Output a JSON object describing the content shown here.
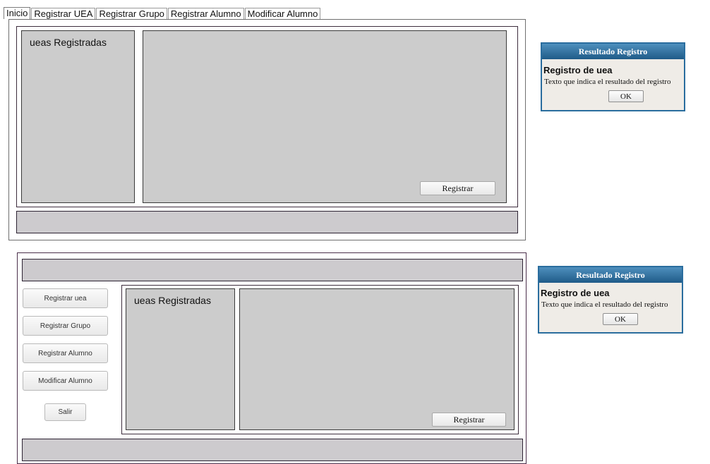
{
  "tabs": [
    "Inicio",
    "Registrar UEA",
    "Registrar Grupo",
    "Registrar Alumno",
    "Modificar Alumno"
  ],
  "mockup1": {
    "list_title": "ueas Registradas",
    "register_button": "Registrar"
  },
  "dialog1": {
    "title": "Resultado Registro",
    "heading": "Registro de uea",
    "message": "Texto que indica el resultado del registro",
    "ok": "OK"
  },
  "mockup2": {
    "sidebar": [
      "Registrar uea",
      "Registrar Grupo",
      "Registrar Alumno",
      "Modificar Alumno"
    ],
    "exit": "Salir",
    "list_title": "ueas Registradas",
    "register_button": "Registrar"
  },
  "dialog2": {
    "title": "Resultado Registro",
    "heading": "Registro de uea",
    "message": "Texto que indica el resultado del registro",
    "ok": "OK"
  }
}
